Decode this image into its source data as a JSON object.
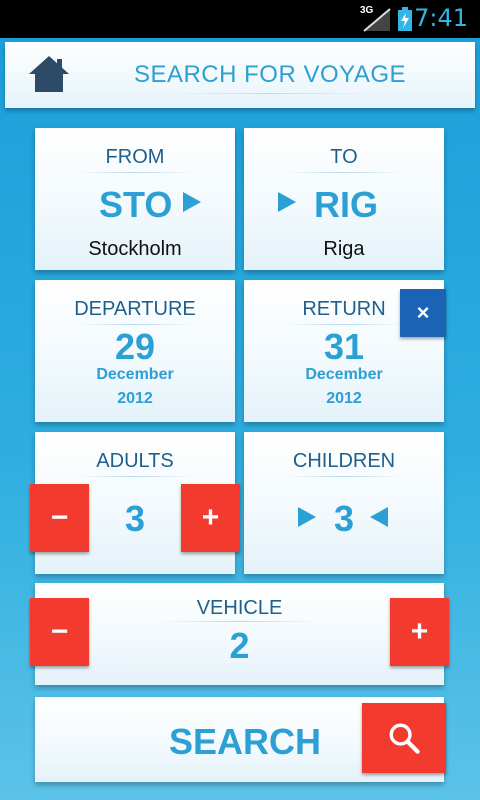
{
  "status_bar": {
    "network": "3G",
    "time": "7:41"
  },
  "header": {
    "title": "SEARCH FOR VOYAGE"
  },
  "route": {
    "from": {
      "label": "FROM",
      "code": "STO",
      "city": "Stockholm"
    },
    "to": {
      "label": "TO",
      "code": "RIG",
      "city": "Riga"
    }
  },
  "departure": {
    "label": "DEPARTURE",
    "day": "29",
    "month": "December",
    "year": "2012"
  },
  "return": {
    "label": "RETURN",
    "day": "31",
    "month": "December",
    "year": "2012",
    "clear_symbol": "×"
  },
  "adults": {
    "label": "ADULTS",
    "count": "3",
    "minus": "−",
    "plus": "+"
  },
  "children": {
    "label": "CHILDREN",
    "count": "3"
  },
  "vehicle": {
    "label": "VEHICLE",
    "count": "2",
    "minus": "−",
    "plus": "+"
  },
  "search": {
    "label": "SEARCH"
  },
  "colors": {
    "accent_blue": "#2c9fd5",
    "label_navy": "#1f5f8c",
    "stepper_red": "#f23a2e",
    "clear_blue": "#1a63b5",
    "background": "#29a8dc"
  },
  "icons": [
    "home-icon",
    "arrow-right-icon",
    "arrow-left-icon",
    "close-icon",
    "search-icon",
    "signal-icon",
    "battery-icon"
  ]
}
